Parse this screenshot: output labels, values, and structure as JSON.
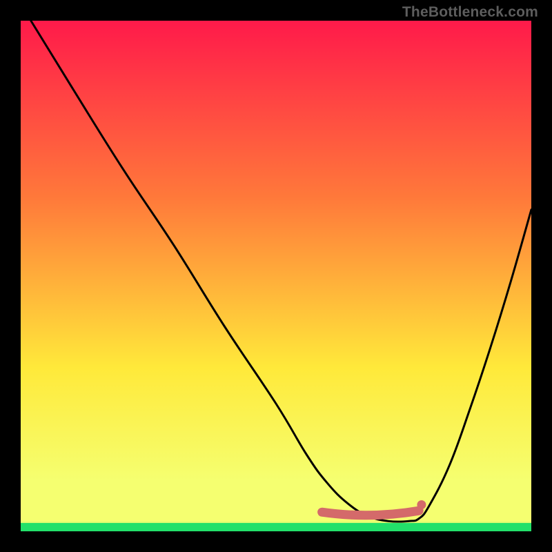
{
  "watermark": "TheBottleneck.com",
  "colors": {
    "background": "#000000",
    "text": "#5d5d5d",
    "gradient_top": "#ff1a4a",
    "gradient_mid1": "#ff7a3a",
    "gradient_mid2": "#ffe93a",
    "gradient_mid3": "#f5ff70",
    "gradient_bottom": "#22e06a",
    "curve": "#000000",
    "marker": "#d46a6a"
  },
  "plot": {
    "inner_x": 30,
    "inner_y": 30,
    "inner_w": 740,
    "inner_h": 740,
    "bottom_band_h": 12
  },
  "chart_data": {
    "type": "line",
    "title": "",
    "xlabel": "",
    "ylabel": "",
    "xlim": [
      0,
      100
    ],
    "ylim": [
      0,
      100
    ],
    "x": [
      2,
      10,
      20,
      30,
      40,
      50,
      56,
      60,
      64,
      68,
      72,
      76,
      78,
      80,
      84,
      88,
      92,
      96,
      100
    ],
    "values": [
      100,
      87,
      71,
      56,
      40,
      25,
      15,
      9.5,
      5.5,
      3,
      2,
      2,
      2.5,
      5,
      13,
      24,
      36,
      49,
      63
    ],
    "trough": {
      "x_range": [
        59,
        78
      ],
      "y": 4.3,
      "end_marker": {
        "x": 78.5,
        "y": 5.2
      }
    }
  }
}
